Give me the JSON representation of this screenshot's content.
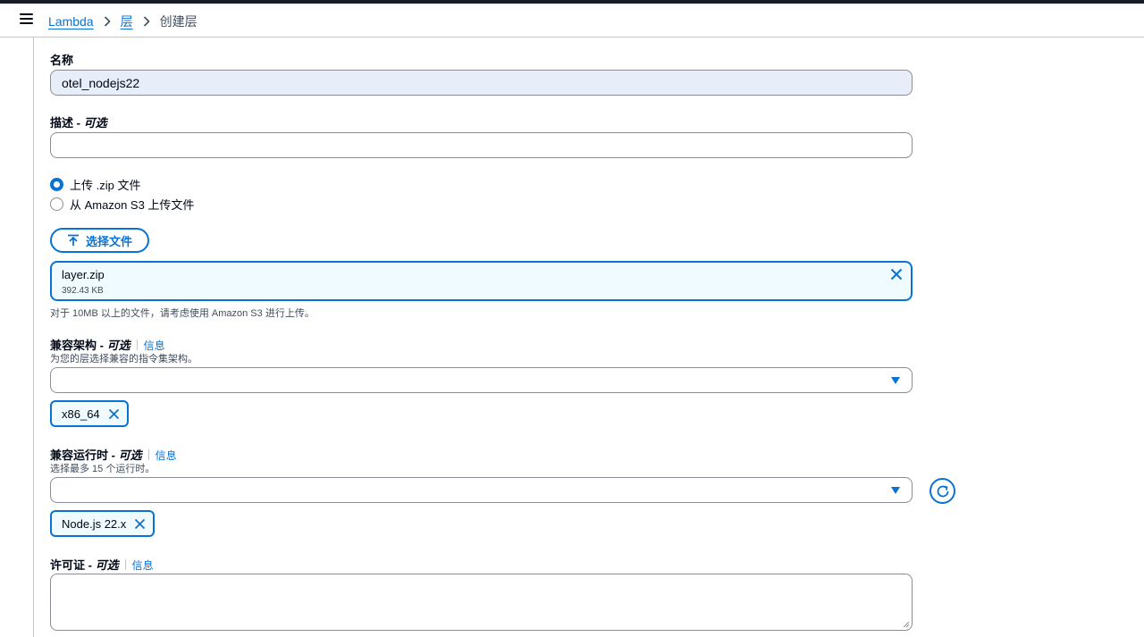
{
  "breadcrumb": {
    "items": [
      "Lambda",
      "层"
    ],
    "current": "创建层"
  },
  "form": {
    "name_label": "名称",
    "name_value": "otel_nodejs22",
    "description_label": "描述",
    "optional_text": "可选",
    "upload_options": [
      "上传 .zip 文件",
      "从 Amazon S3 上传文件"
    ],
    "upload_selected": 0,
    "choose_file_label": "选择文件",
    "file": {
      "name": "layer.zip",
      "size": "392.43 KB"
    },
    "file_hint": "对于 10MB 以上的文件，请考虑使用 Amazon S3 进行上传。",
    "architecture": {
      "label": "兼容架构",
      "info": "信息",
      "description": "为您的层选择兼容的指令集架构。",
      "tokens": [
        "x86_64"
      ]
    },
    "runtime": {
      "label": "兼容运行时",
      "info": "信息",
      "description": "选择最多 15 个运行时。",
      "tokens": [
        "Node.js 22.x"
      ]
    },
    "license": {
      "label": "许可证",
      "info": "信息"
    }
  },
  "colors": {
    "accent": "#0972d3",
    "border": "#8c8c94",
    "filled_bg": "#e8edfa",
    "token_bg": "#f0fbff"
  },
  "icons": {
    "menu": "hamburger-icon",
    "separator": "chevron-right-icon",
    "upload": "upload-icon",
    "remove": "close-icon",
    "dropdown": "caret-down-icon",
    "refresh": "refresh-icon",
    "resize": "resize-handle-icon"
  }
}
